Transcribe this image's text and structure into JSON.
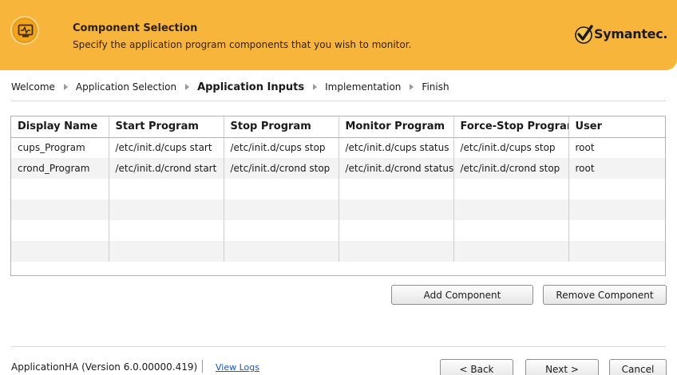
{
  "header": {
    "title": "Component Selection",
    "subtitle": "Specify the application program components that you wish to monitor.",
    "brand": "Symantec",
    "brand_dot": ".",
    "accent_color": "#f7b53b"
  },
  "breadcrumb": {
    "steps": [
      {
        "label": "Welcome",
        "active": false
      },
      {
        "label": "Application Selection",
        "active": false
      },
      {
        "label": "Application Inputs",
        "active": true
      },
      {
        "label": "Implementation",
        "active": false
      },
      {
        "label": "Finish",
        "active": false
      }
    ]
  },
  "table": {
    "columns": [
      "Display Name",
      "Start Program",
      "Stop Program",
      "Monitor Program",
      "Force-Stop Program",
      "User"
    ],
    "rows": [
      [
        "cups_Program",
        "/etc/init.d/cups start",
        "/etc/init.d/cups stop",
        "/etc/init.d/cups status",
        "/etc/init.d/cups stop",
        "root"
      ],
      [
        "crond_Program",
        "/etc/init.d/crond start",
        "/etc/init.d/crond stop",
        "/etc/init.d/crond status",
        "/etc/init.d/crond stop",
        "root"
      ]
    ]
  },
  "actions": {
    "add_label": "Add Component",
    "remove_label": "Remove Component"
  },
  "footer": {
    "version": "ApplicationHA (Version 6.0.00000.419)",
    "view_logs": "View Logs",
    "back_label": "< Back",
    "next_label": "Next >",
    "cancel_label": "Cancel"
  }
}
